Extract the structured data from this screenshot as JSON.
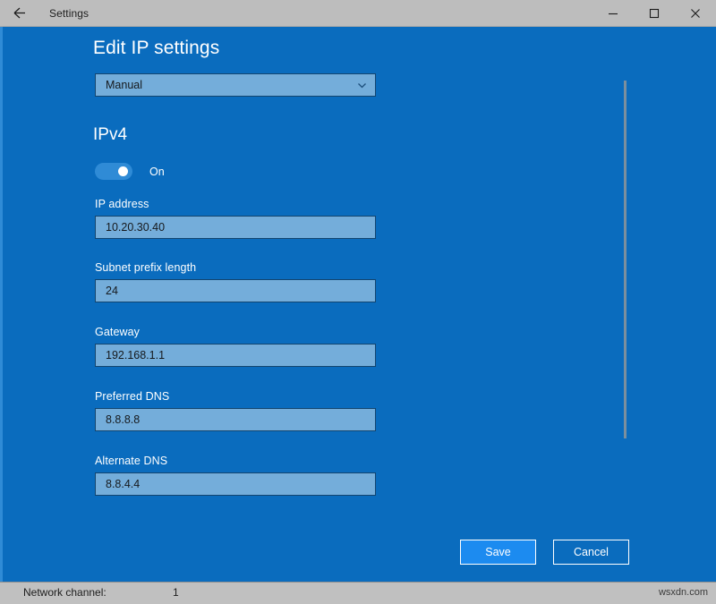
{
  "window": {
    "title": "Settings",
    "back_icon": "back-arrow-icon",
    "controls": {
      "minimize": "minimize-icon",
      "maximize": "maximize-icon",
      "close": "close-icon"
    }
  },
  "page": {
    "title": "Edit IP settings",
    "assignment": {
      "selected": "Manual",
      "chevron_icon": "chevron-down-icon",
      "options": [
        "Manual"
      ]
    },
    "section": {
      "heading": "IPv4",
      "toggle": {
        "label": "On",
        "state": "on"
      }
    },
    "fields": [
      {
        "label": "IP address",
        "value": "10.20.30.40"
      },
      {
        "label": "Subnet prefix length",
        "value": "24"
      },
      {
        "label": "Gateway",
        "value": "192.168.1.1"
      },
      {
        "label": "Preferred DNS",
        "value": "8.8.8.8"
      },
      {
        "label": "Alternate DNS",
        "value": "8.8.4.4"
      }
    ],
    "actions": {
      "save": "Save",
      "cancel": "Cancel"
    }
  },
  "statusbar": {
    "label": "Network channel:",
    "value": "1",
    "watermark": "wsxdn.com"
  },
  "colors": {
    "window_background": "#0a6cbe",
    "titlebar": "#bdbdbd",
    "input_fill": "#74adda",
    "input_border": "#13456f",
    "accent_toggle": "#2f8bd6",
    "primary_button": "#1c8bf0",
    "statusbar": "#c0c0c0"
  }
}
